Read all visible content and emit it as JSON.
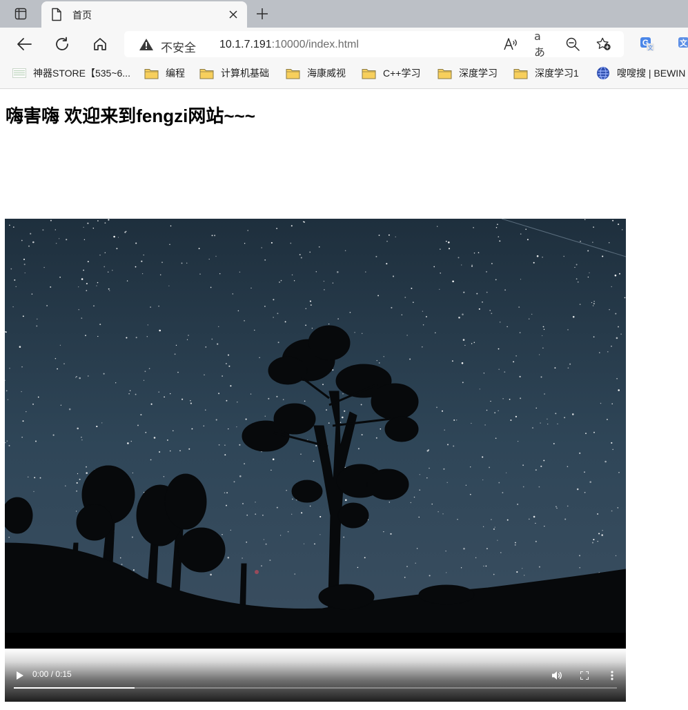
{
  "browser": {
    "tab": {
      "title": "首页"
    },
    "address": {
      "security_label": "不安全",
      "url_host": "10.1.7.191",
      "url_rest": ":10000/index.html"
    },
    "omnibox_icons": [
      "read-aloud-icon",
      "translate-text-icon",
      "zoom-out-icon",
      "favorite-add-icon"
    ],
    "bookmarks": [
      {
        "label": "神器STORE【535~6...",
        "icon": "page-favicon"
      },
      {
        "label": "编程",
        "icon": "folder-icon"
      },
      {
        "label": "计算机基础",
        "icon": "folder-icon"
      },
      {
        "label": "海康威视",
        "icon": "folder-icon"
      },
      {
        "label": "C++学习",
        "icon": "folder-icon"
      },
      {
        "label": "深度学习",
        "icon": "folder-icon"
      },
      {
        "label": "深度学习1",
        "icon": "folder-icon"
      },
      {
        "label": "嗖嗖搜 | BEWIN",
        "icon": "globe-icon"
      }
    ]
  },
  "page": {
    "heading": "嗨害嗨 欢迎来到fengzi网站~~~",
    "video": {
      "time": "0:00 / 0:15",
      "progress": 0.2,
      "scene": "night sky with stars over tree silhouettes"
    }
  },
  "colors": {
    "tab_strip": "#bcc0c6",
    "toolbar": "#f7f7f7",
    "folder": "#f5c84c",
    "sky": "#2b3f52"
  }
}
